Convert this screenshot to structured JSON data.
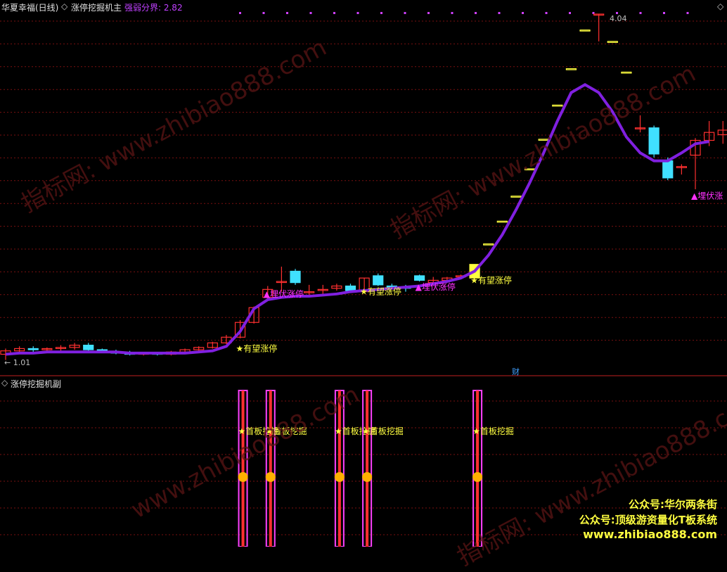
{
  "header": {
    "stock_name": "华夏幸福(日线)",
    "indicator_main": "涨停挖掘机主",
    "strength_label": "强弱分界: 2.82",
    "collapse_glyph": "◇",
    "nav_glyph": "◇"
  },
  "sub_header": {
    "indicator_sub": "涨停挖掘机副"
  },
  "price_marks": {
    "high": "4.04",
    "low": "← 1.01",
    "fin_badge": "财"
  },
  "watermarks": [
    "指标网: www.zhibiao888.com",
    "指标网: www.zhibiao888.com",
    "www.zhibiao888.com",
    "指标网: www.zhibiao888.com"
  ],
  "footer": {
    "line1": "公众号:华尔两条街",
    "line2": "公众号:顶级游资量化T板系统",
    "line3": "www.zhibiao888.com"
  },
  "colors": {
    "up": "#ff3030",
    "down": "#40e0ff",
    "ma_line": "#8020e0",
    "signal_yellow": "#ffff40",
    "signal_magenta": "#ff30ff",
    "grid": "#7a1010"
  },
  "chart_data": {
    "type": "candlestick",
    "price_range": [
      1.01,
      4.04
    ],
    "candles": [
      {
        "o": 1.05,
        "h": 1.1,
        "l": 1.0,
        "c": 1.08
      },
      {
        "o": 1.08,
        "h": 1.12,
        "l": 1.05,
        "c": 1.1
      },
      {
        "o": 1.1,
        "h": 1.12,
        "l": 1.07,
        "c": 1.09
      },
      {
        "o": 1.09,
        "h": 1.11,
        "l": 1.08,
        "c": 1.1
      },
      {
        "o": 1.1,
        "h": 1.13,
        "l": 1.08,
        "c": 1.11
      },
      {
        "o": 1.11,
        "h": 1.15,
        "l": 1.09,
        "c": 1.13
      },
      {
        "o": 1.13,
        "h": 1.15,
        "l": 1.08,
        "c": 1.09
      },
      {
        "o": 1.09,
        "h": 1.1,
        "l": 1.06,
        "c": 1.07
      },
      {
        "o": 1.07,
        "h": 1.09,
        "l": 1.05,
        "c": 1.06
      },
      {
        "o": 1.06,
        "h": 1.08,
        "l": 1.04,
        "c": 1.05
      },
      {
        "o": 1.05,
        "h": 1.07,
        "l": 1.04,
        "c": 1.06
      },
      {
        "o": 1.06,
        "h": 1.07,
        "l": 1.04,
        "c": 1.05
      },
      {
        "o": 1.05,
        "h": 1.08,
        "l": 1.04,
        "c": 1.07
      },
      {
        "o": 1.07,
        "h": 1.1,
        "l": 1.06,
        "c": 1.09
      },
      {
        "o": 1.09,
        "h": 1.12,
        "l": 1.08,
        "c": 1.11
      },
      {
        "o": 1.11,
        "h": 1.16,
        "l": 1.1,
        "c": 1.15
      },
      {
        "o": 1.15,
        "h": 1.22,
        "l": 1.14,
        "c": 1.2
      },
      {
        "o": 1.2,
        "h": 1.35,
        "l": 1.19,
        "c": 1.33
      },
      {
        "o": 1.33,
        "h": 1.47,
        "l": 1.32,
        "c": 1.46
      },
      {
        "o": 1.55,
        "h": 1.65,
        "l": 1.52,
        "c": 1.62
      },
      {
        "o": 1.69,
        "h": 1.82,
        "l": 1.6,
        "c": 1.69
      },
      {
        "o": 1.78,
        "h": 1.8,
        "l": 1.66,
        "c": 1.68
      },
      {
        "o": 1.6,
        "h": 1.66,
        "l": 1.56,
        "c": 1.6
      },
      {
        "o": 1.62,
        "h": 1.66,
        "l": 1.58,
        "c": 1.62
      },
      {
        "o": 1.63,
        "h": 1.67,
        "l": 1.61,
        "c": 1.65
      },
      {
        "o": 1.65,
        "h": 1.67,
        "l": 1.6,
        "c": 1.61
      },
      {
        "o": 1.6,
        "h": 1.72,
        "l": 1.59,
        "c": 1.72
      },
      {
        "o": 1.74,
        "h": 1.76,
        "l": 1.65,
        "c": 1.66
      },
      {
        "o": 1.65,
        "h": 1.67,
        "l": 1.62,
        "c": 1.64
      },
      {
        "o": 1.64,
        "h": 1.66,
        "l": 1.6,
        "c": 1.63
      },
      {
        "o": 1.74,
        "h": 1.75,
        "l": 1.69,
        "c": 1.7
      },
      {
        "o": 1.68,
        "h": 1.73,
        "l": 1.67,
        "c": 1.7
      },
      {
        "o": 1.7,
        "h": 1.73,
        "l": 1.68,
        "c": 1.72
      },
      {
        "o": 1.73,
        "h": 1.75,
        "l": 1.71,
        "c": 1.74
      },
      {
        "o": 1.72,
        "h": 1.84,
        "l": 1.72,
        "c": 1.84
      },
      {
        "o": 2.02,
        "h": 2.02,
        "l": 2.02,
        "c": 2.02
      },
      {
        "o": 2.22,
        "h": 2.22,
        "l": 2.22,
        "c": 2.22
      },
      {
        "o": 2.44,
        "h": 2.44,
        "l": 2.44,
        "c": 2.44
      },
      {
        "o": 2.68,
        "h": 2.68,
        "l": 2.68,
        "c": 2.68
      },
      {
        "o": 2.94,
        "h": 2.94,
        "l": 2.94,
        "c": 2.94
      },
      {
        "o": 3.24,
        "h": 3.24,
        "l": 3.24,
        "c": 3.24
      },
      {
        "o": 3.56,
        "h": 3.56,
        "l": 3.56,
        "c": 3.56
      },
      {
        "o": 3.9,
        "h": 3.9,
        "l": 3.9,
        "c": 3.9
      },
      {
        "o": 4.04,
        "h": 4.04,
        "l": 3.8,
        "c": 4.04
      },
      {
        "o": 3.8,
        "h": 3.8,
        "l": 3.8,
        "c": 3.8
      },
      {
        "o": 3.53,
        "h": 3.53,
        "l": 3.53,
        "c": 3.53
      },
      {
        "o": 3.04,
        "h": 3.15,
        "l": 3.0,
        "c": 3.04
      },
      {
        "o": 3.04,
        "h": 3.06,
        "l": 2.78,
        "c": 2.81
      },
      {
        "o": 2.75,
        "h": 2.78,
        "l": 2.58,
        "c": 2.6
      },
      {
        "o": 2.69,
        "h": 2.72,
        "l": 2.63,
        "c": 2.7
      },
      {
        "o": 2.8,
        "h": 2.95,
        "l": 2.5,
        "c": 2.93
      },
      {
        "o": 2.93,
        "h": 3.1,
        "l": 2.88,
        "c": 3.0
      },
      {
        "o": 2.98,
        "h": 3.1,
        "l": 2.9,
        "c": 3.02
      }
    ],
    "ma_line": [
      1.05,
      1.06,
      1.06,
      1.07,
      1.07,
      1.07,
      1.07,
      1.07,
      1.07,
      1.06,
      1.06,
      1.06,
      1.06,
      1.06,
      1.07,
      1.08,
      1.12,
      1.25,
      1.45,
      1.53,
      1.55,
      1.56,
      1.56,
      1.57,
      1.58,
      1.6,
      1.61,
      1.62,
      1.63,
      1.64,
      1.65,
      1.67,
      1.69,
      1.72,
      1.78,
      1.92,
      2.1,
      2.32,
      2.56,
      2.82,
      3.1,
      3.35,
      3.42,
      3.35,
      3.18,
      2.96,
      2.82,
      2.75,
      2.75,
      2.82,
      2.9,
      2.92
    ],
    "signals_main": [
      {
        "i": 17,
        "text": "★有望涨停",
        "color": "yellow",
        "price": 1.1
      },
      {
        "i": 19,
        "text": "▲埋伏涨停",
        "color": "magenta",
        "price": 1.58
      },
      {
        "i": 26,
        "text": "★有望涨停",
        "color": "yellow",
        "price": 1.6
      },
      {
        "i": 30,
        "text": "▲埋伏涨停",
        "color": "magenta",
        "price": 1.64
      },
      {
        "i": 34,
        "text": "★有望涨停",
        "color": "yellow",
        "price": 1.7
      },
      {
        "i": 50,
        "text": "▲埋伏涨",
        "color": "magenta",
        "price": 2.44
      }
    ],
    "signals_sub": [
      {
        "i": 17,
        "text": "★首板挖掘"
      },
      {
        "i": 19,
        "text": "★首板挖掘"
      },
      {
        "i": 24,
        "text": "★首板挖掘"
      },
      {
        "i": 26,
        "text": "★首板挖掘"
      },
      {
        "i": 34,
        "text": "★首板挖掘"
      }
    ]
  }
}
